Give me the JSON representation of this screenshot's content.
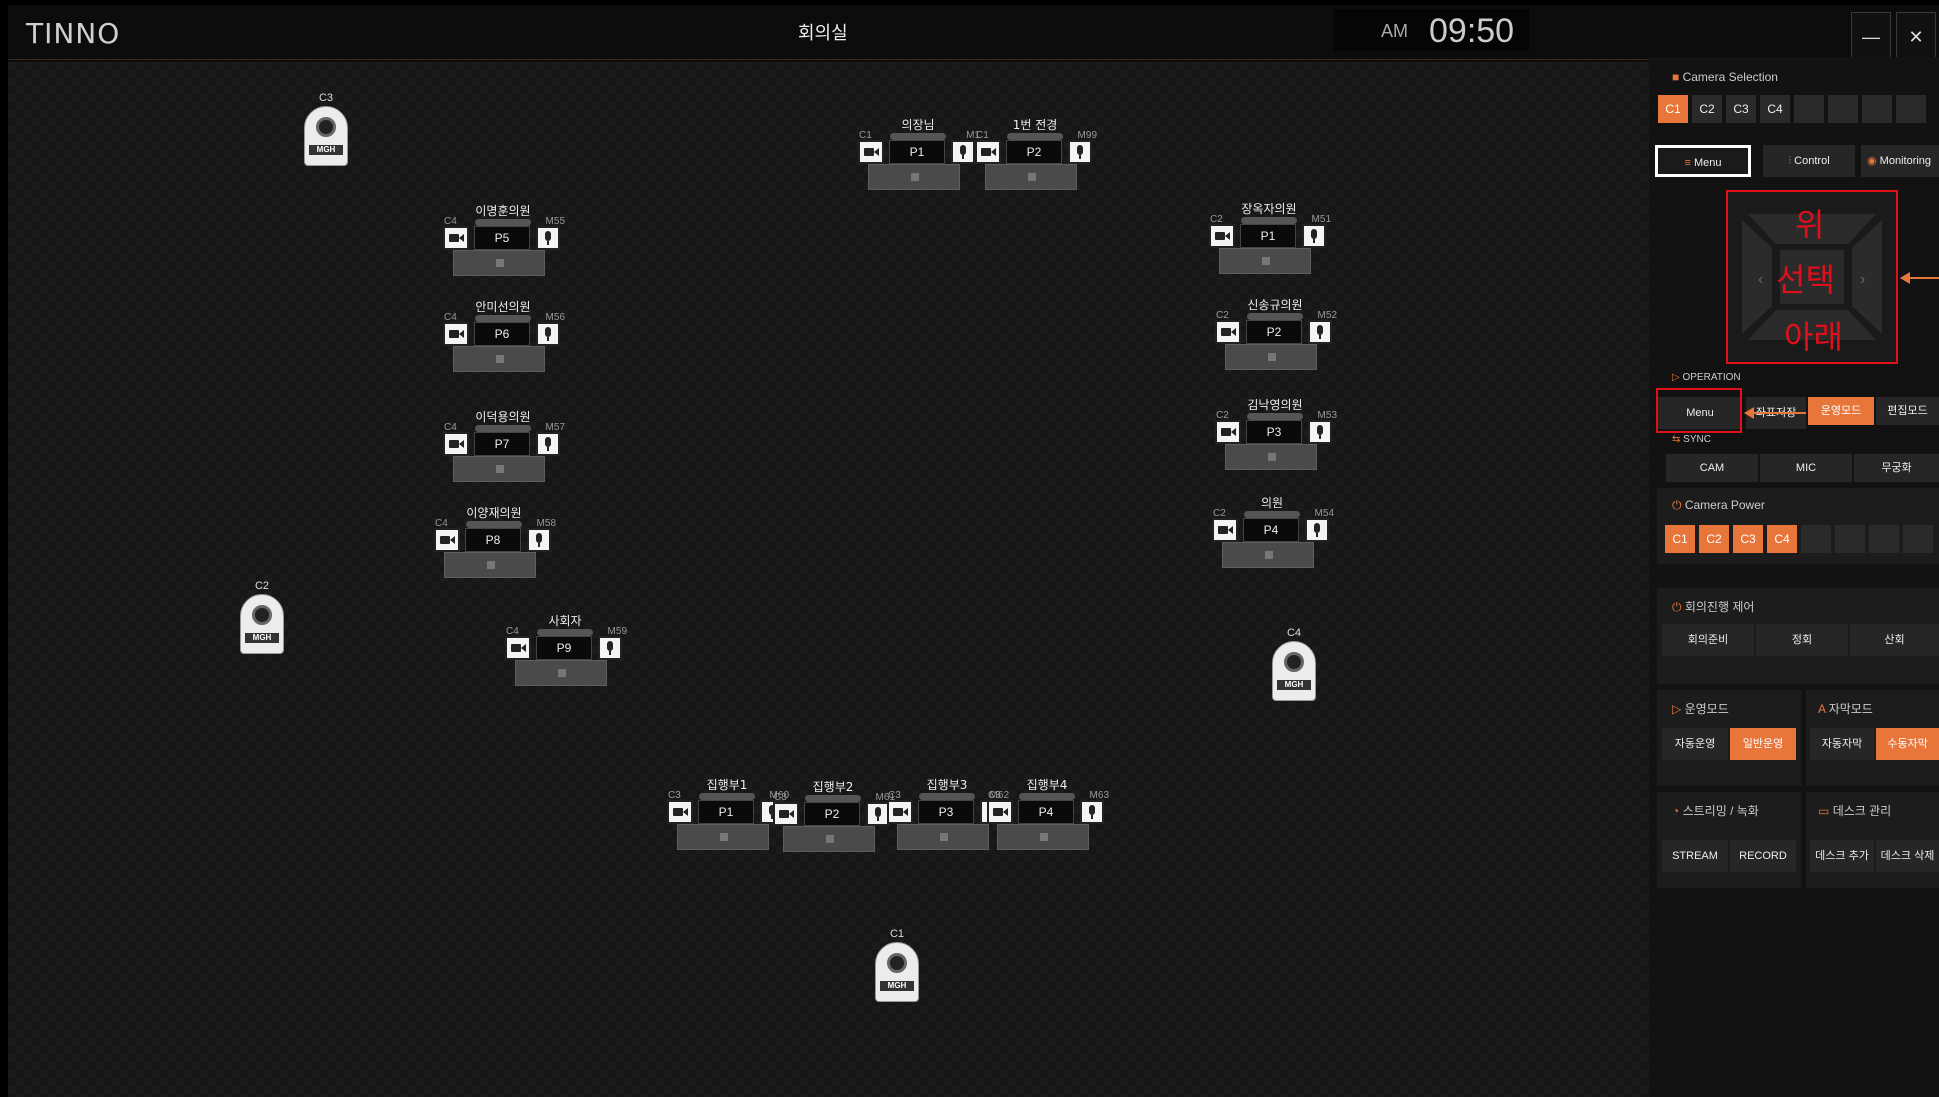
{
  "app": {
    "logo": "TINNO",
    "room": "회의실",
    "ampm": "AM",
    "time": "09:50",
    "min": "—",
    "close": "✕"
  },
  "desks": [
    {
      "name": "의장님",
      "cam": "C1",
      "mic": "M1",
      "seat": "P1"
    },
    {
      "name": "1번 전경",
      "cam": "C1",
      "mic": "M99",
      "seat": "P2"
    },
    {
      "name": "이명훈의원",
      "cam": "C4",
      "mic": "M55",
      "seat": "P5"
    },
    {
      "name": "안미선의원",
      "cam": "C4",
      "mic": "M56",
      "seat": "P6"
    },
    {
      "name": "이덕용의원",
      "cam": "C4",
      "mic": "M57",
      "seat": "P7"
    },
    {
      "name": "이양재의원",
      "cam": "C4",
      "mic": "M58",
      "seat": "P8"
    },
    {
      "name": "사회자",
      "cam": "C4",
      "mic": "M59",
      "seat": "P9"
    },
    {
      "name": "장옥자의원",
      "cam": "C2",
      "mic": "M51",
      "seat": "P1"
    },
    {
      "name": "신송규의원",
      "cam": "C2",
      "mic": "M52",
      "seat": "P2"
    },
    {
      "name": "김낙영의원",
      "cam": "C2",
      "mic": "M53",
      "seat": "P3"
    },
    {
      "name": "의원",
      "cam": "C2",
      "mic": "M54",
      "seat": "P4"
    },
    {
      "name": "집행부1",
      "cam": "C3",
      "mic": "M60",
      "seat": "P1"
    },
    {
      "name": "집행부2",
      "cam": "C3",
      "mic": "M61",
      "seat": "P2"
    },
    {
      "name": "집행부3",
      "cam": "C3",
      "mic": "M62",
      "seat": "P3"
    },
    {
      "name": "집행부4",
      "cam": "C3",
      "mic": "M63",
      "seat": "P4"
    }
  ],
  "cameras": [
    {
      "label": "C3",
      "logo": "MGH"
    },
    {
      "label": "C2",
      "logo": "MGH"
    },
    {
      "label": "C4",
      "logo": "MGH"
    },
    {
      "label": "C1",
      "logo": "MGH"
    }
  ],
  "panel": {
    "cam_sel_title": "Camera Selection",
    "cam_sel": [
      "C1",
      "C2",
      "C3",
      "C4"
    ],
    "tabs": [
      "Menu",
      "Control",
      "Monitoring"
    ],
    "dpad": {
      "up": "위",
      "center": "선택",
      "down": "아래"
    },
    "op_title": "OPERATION",
    "op": [
      "Menu",
      "좌표저장",
      "운영모드",
      "편집모드"
    ],
    "sync_title": "SYNC",
    "sync": [
      "CAM",
      "MIC",
      "무궁화"
    ],
    "power_title": "Camera Power",
    "power": [
      "C1",
      "C2",
      "C3",
      "C4"
    ],
    "meet_title": "회의진행 제어",
    "meet": [
      "회의준비",
      "정회",
      "산회"
    ],
    "run_title": "운영모드",
    "run": [
      "자동운영",
      "일반운영"
    ],
    "sub_title": "자막모드",
    "sub": [
      "자동자막",
      "수동자막"
    ],
    "stream_title": "스트리밍 / 녹화",
    "stream": [
      "STREAM",
      "RECORD"
    ],
    "desk_title": "데스크 관리",
    "desk": [
      "데스크 추가",
      "데스크 삭제"
    ]
  }
}
